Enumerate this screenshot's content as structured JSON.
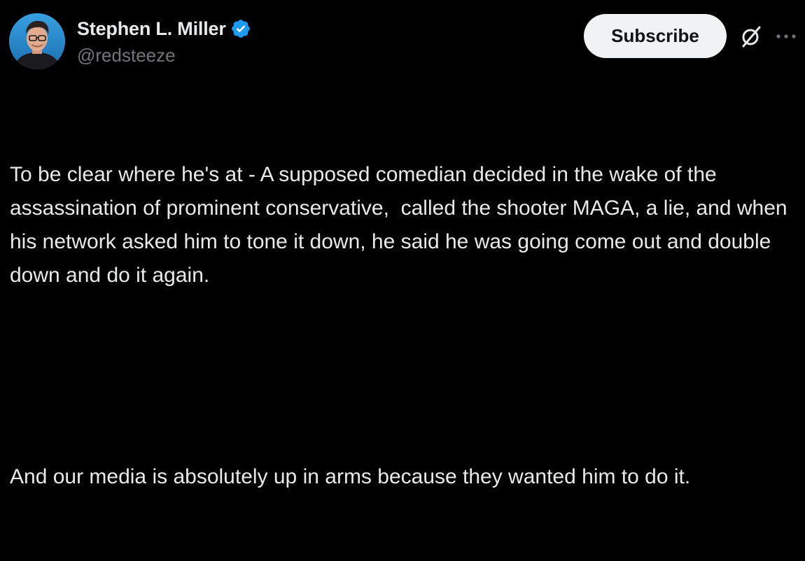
{
  "author": {
    "display_name": "Stephen L. Miller",
    "handle": "@redsteeze",
    "verified": true,
    "verified_color": "#1d9bf0"
  },
  "actions": {
    "subscribe_label": "Subscribe",
    "grok_icon": "grok-icon",
    "more_icon": "more-icon"
  },
  "tweet": {
    "paragraphs": [
      "To be clear where he's at - A supposed comedian decided in the wake of the assassination of prominent conservative,  called the shooter MAGA, a lie, and when his network asked him to tone it down, he said he was going come out and double down and do it again.",
      "And our media is absolutely up in arms because they wanted him to do it."
    ]
  },
  "theme": {
    "background": "#000000",
    "text": "#e7e9ea",
    "secondary_text": "#71767b",
    "button_bg": "#eff3f4"
  }
}
